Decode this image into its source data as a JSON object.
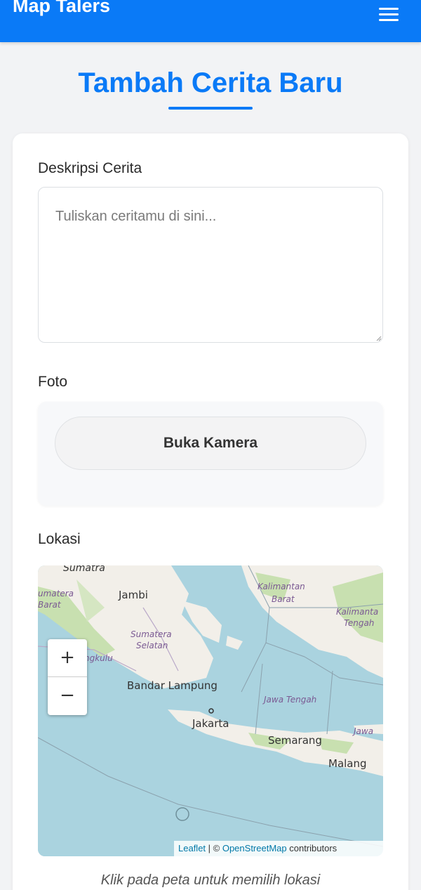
{
  "app": {
    "brand": "Map Talers",
    "menu_icon": "hamburger-menu-icon"
  },
  "page": {
    "title": "Tambah Cerita Baru"
  },
  "form": {
    "description_label": "Deskripsi Cerita",
    "description_placeholder": "Tuliskan ceritamu di sini...",
    "description_value": "",
    "photo_label": "Foto",
    "camera_button": "Buka Kamera",
    "location_label": "Lokasi",
    "map_hint": "Klik pada peta untuk memilih lokasi"
  },
  "map": {
    "zoom_in": "+",
    "zoom_out": "−",
    "attribution": {
      "leaflet": "Leaflet",
      "separator": " | © ",
      "osm": "OpenStreetMap",
      "suffix": " contributors"
    },
    "places": {
      "sumatra": "Sumatra",
      "sumatera_barat_1": "umatera",
      "sumatera_barat_2": "Barat",
      "jambi": "Jambi",
      "sumatera_selatan_1": "Sumatera",
      "sumatera_selatan_2": "Selatan",
      "bengkulu": "ngkulu",
      "bandar_lampung": "Bandar Lampung",
      "jakarta": "Jakarta",
      "jawa_tengah": "Jawa Tengah",
      "jawa_timur": "Jawa",
      "semarang": "Semarang",
      "malang": "Malang",
      "kalbar_1": "Kalimantan",
      "kalbar_2": "Barat",
      "kalteng_1": "Kalimanta",
      "kalteng_2": "Tengah"
    }
  },
  "colors": {
    "primary": "#0a7af7",
    "water": "#aad3df",
    "land": "#f2efe9",
    "forest": "#c8e0b0"
  }
}
